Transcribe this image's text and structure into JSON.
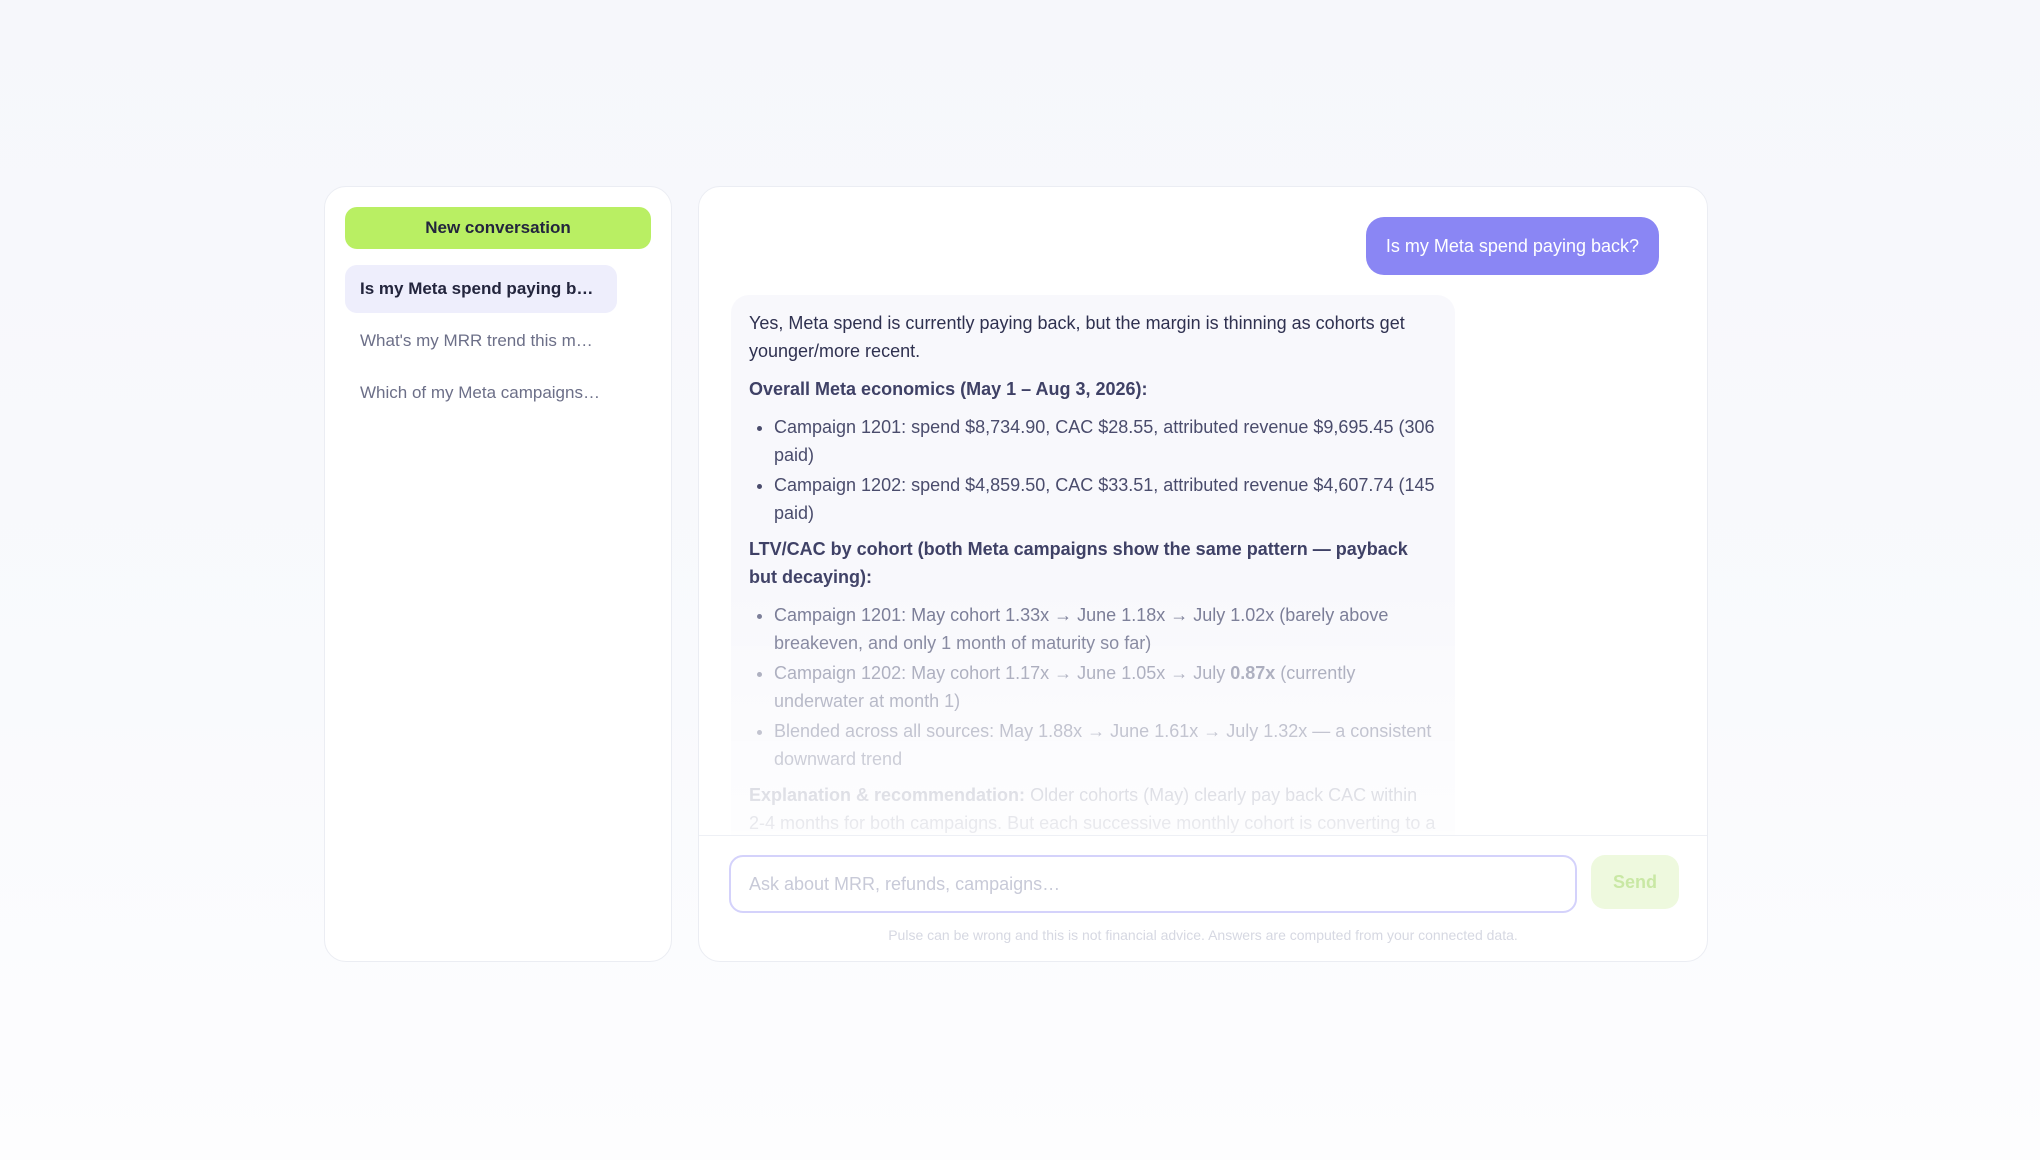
{
  "sidebar": {
    "new_label": "New conversation",
    "items": [
      {
        "label": "Is my Meta spend paying back?"
      },
      {
        "label": "What's my MRR trend this month?"
      },
      {
        "label": "Which of my Meta campaigns are paying back?"
      }
    ]
  },
  "chat": {
    "user_message": "Is my Meta spend paying back?",
    "assistant": {
      "intro": "Yes, Meta spend is currently paying back, but the margin is thinning as cohorts get younger/more recent.",
      "section1_title": "Overall Meta economics (May 1 – Aug 3, 2026):",
      "section1_items": [
        "Campaign 1201: spend $8,734.90, CAC $28.55, attributed revenue $9,695.45 (306 paid)",
        "Campaign 1202: spend $4,859.50, CAC $33.51, attributed revenue $4,607.74 (145 paid)"
      ],
      "section2_title": "LTV/CAC by cohort (both Meta campaigns show the same pattern — payback but decaying):",
      "section2_item1": "Campaign 1201: May cohort 1.33x → June 1.18x → July 1.02x (barely above breakeven, and only 1 month of maturity so far)",
      "section2_item2_pre": "Campaign 1202: May cohort 1.17x → June 1.05x → July ",
      "section2_item2_bold": "0.87x",
      "section2_item2_post": " (currently underwater at month 1)",
      "section2_item3": "Blended across all sources: May 1.88x → June 1.61x → July 1.32x — a consistent downward trend",
      "section3_title": "Explanation & recommendation:",
      "section3_text": "Older cohorts (May) clearly pay back CAC within 2-4 months for both campaigns. But each successive monthly cohort is converting to a lower value per paid subscriber, so newer cohorts may not recover CAC until they've matured."
    }
  },
  "composer": {
    "placeholder": "Ask about MRR, refunds, campaigns…",
    "send_label": "Send",
    "disclaimer": "Pulse can be wrong and this is not financial advice. Answers are computed from your connected data."
  }
}
